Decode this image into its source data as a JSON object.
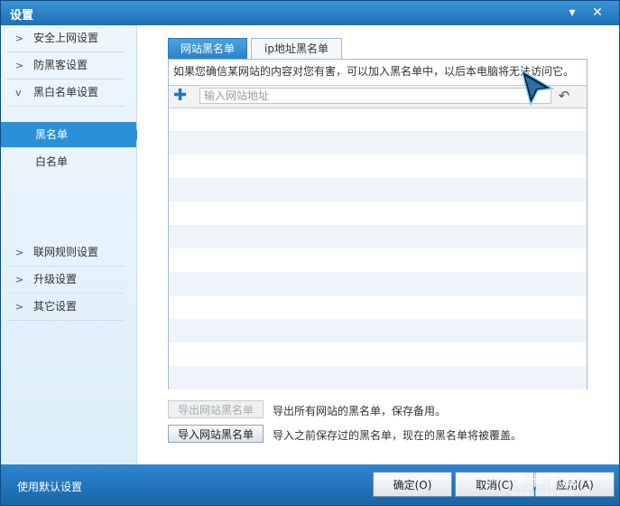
{
  "window": {
    "title": "设置",
    "minimize_glyph": "▾",
    "close_glyph": "✕"
  },
  "sidebar": {
    "items": [
      {
        "label": "安全上网设置",
        "expanded": false
      },
      {
        "label": "防黑客设置",
        "expanded": false
      },
      {
        "label": "黑白名单设置",
        "expanded": true
      },
      {
        "label": "联网规则设置",
        "expanded": false
      },
      {
        "label": "升级设置",
        "expanded": false
      },
      {
        "label": "其它设置",
        "expanded": false
      }
    ],
    "subitems": [
      {
        "label": "黑名单",
        "active": true
      },
      {
        "label": "白名单",
        "active": false
      }
    ]
  },
  "tabs": [
    {
      "label": "网站黑名单",
      "active": true
    },
    {
      "label": "ip地址黑名单",
      "active": false
    }
  ],
  "panel": {
    "notice": "如果您确信某网站的内容对您有害，可以加入黑名单中，以后本电脑将无法访问它。",
    "input_placeholder": "输入网站地址",
    "input_value": ""
  },
  "actions": {
    "export_label": "导出网站黑名单",
    "export_desc": "导出所有网站的黑名单，保存备用。",
    "import_label": "导入网站黑名单",
    "import_desc": "导入之前保存过的黑名单，现在的黑名单将被覆盖。"
  },
  "footer": {
    "defaults_label": "使用默认设置",
    "ok_label": "确定(O)",
    "cancel_label": "取消(C)",
    "apply_label": "应用(A)"
  },
  "watermark": {
    "text": "卡卡下载",
    "sub": "www.ikaka.com"
  },
  "colors": {
    "accent": "#2b91d6",
    "title_bar": "#1d6fb3",
    "footer": "#1a65a8"
  }
}
